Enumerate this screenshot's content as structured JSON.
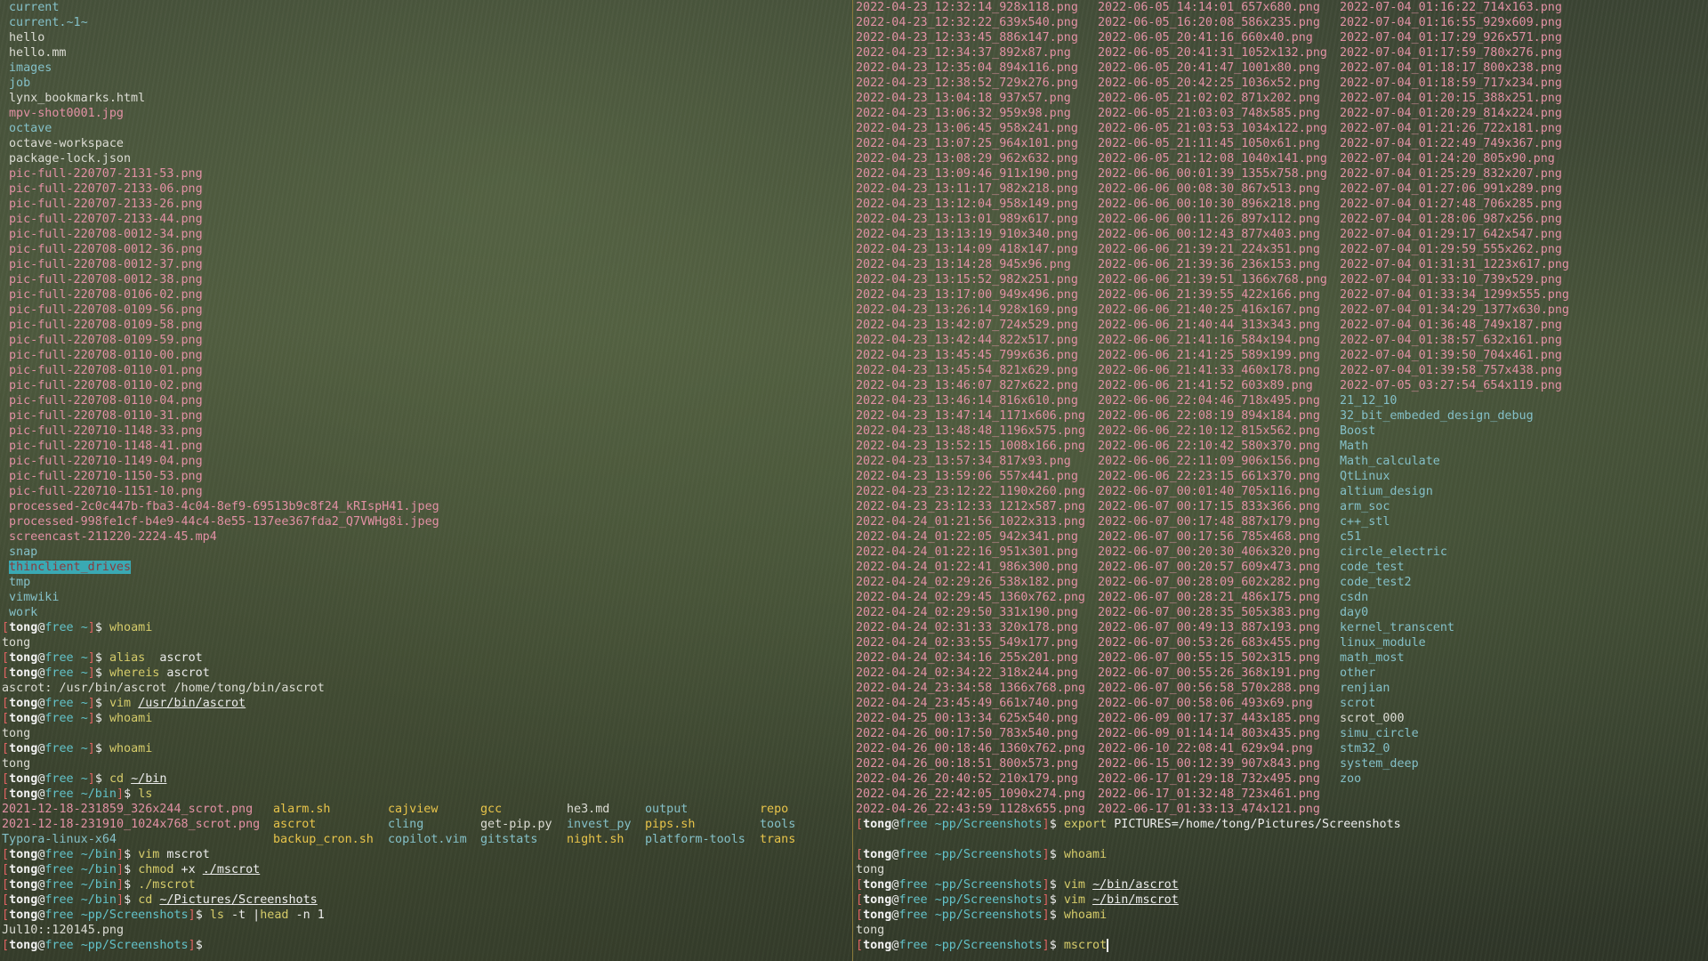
{
  "left": {
    "listing": [
      {
        "t": "current",
        "c": "dir"
      },
      {
        "t": "current.~1~",
        "c": "dir"
      },
      {
        "t": "hello",
        "c": "file"
      },
      {
        "t": "hello.mm",
        "c": "file"
      },
      {
        "t": "images",
        "c": "dir"
      },
      {
        "t": "job",
        "c": "dir"
      },
      {
        "t": "lynx_bookmarks.html",
        "c": "file"
      },
      {
        "t": "mpv-shot0001.jpg",
        "c": "img"
      },
      {
        "t": "octave",
        "c": "dir"
      },
      {
        "t": "octave-workspace",
        "c": "file"
      },
      {
        "t": "package-lock.json",
        "c": "file"
      },
      {
        "t": "pic-full-220707-2131-53.png",
        "c": "img"
      },
      {
        "t": "pic-full-220707-2133-06.png",
        "c": "img"
      },
      {
        "t": "pic-full-220707-2133-26.png",
        "c": "img"
      },
      {
        "t": "pic-full-220707-2133-44.png",
        "c": "img"
      },
      {
        "t": "pic-full-220708-0012-34.png",
        "c": "img"
      },
      {
        "t": "pic-full-220708-0012-36.png",
        "c": "img"
      },
      {
        "t": "pic-full-220708-0012-37.png",
        "c": "img"
      },
      {
        "t": "pic-full-220708-0012-38.png",
        "c": "img"
      },
      {
        "t": "pic-full-220708-0106-02.png",
        "c": "img"
      },
      {
        "t": "pic-full-220708-0109-56.png",
        "c": "img"
      },
      {
        "t": "pic-full-220708-0109-58.png",
        "c": "img"
      },
      {
        "t": "pic-full-220708-0109-59.png",
        "c": "img"
      },
      {
        "t": "pic-full-220708-0110-00.png",
        "c": "img"
      },
      {
        "t": "pic-full-220708-0110-01.png",
        "c": "img"
      },
      {
        "t": "pic-full-220708-0110-02.png",
        "c": "img"
      },
      {
        "t": "pic-full-220708-0110-04.png",
        "c": "img"
      },
      {
        "t": "pic-full-220708-0110-31.png",
        "c": "img"
      },
      {
        "t": "pic-full-220710-1148-33.png",
        "c": "img"
      },
      {
        "t": "pic-full-220710-1148-41.png",
        "c": "img"
      },
      {
        "t": "pic-full-220710-1149-04.png",
        "c": "img"
      },
      {
        "t": "pic-full-220710-1150-53.png",
        "c": "img"
      },
      {
        "t": "pic-full-220710-1151-10.png",
        "c": "img"
      },
      {
        "t": "processed-2c0c447b-fba3-4c04-8ef9-69513b9c8f24_kRIspH41.jpeg",
        "c": "img"
      },
      {
        "t": "processed-998fe1cf-b4e9-44c4-8e55-137ee367fda2_Q7VWHg8i.jpeg",
        "c": "img"
      },
      {
        "t": "screencast-211220-2224-45.mp4",
        "c": "img"
      },
      {
        "t": "snap",
        "c": "dir"
      },
      {
        "t": "thinclient_drives",
        "c": "hl"
      },
      {
        "t": "tmp",
        "c": "dir"
      },
      {
        "t": "vimwiki",
        "c": "dir"
      },
      {
        "t": "work",
        "c": "dir"
      }
    ],
    "session1": [
      {
        "type": "prompt",
        "user": "tong",
        "host": "free",
        "dir": "~",
        "parts": [
          {
            "t": "whoami",
            "c": "cmd"
          }
        ]
      },
      {
        "type": "out",
        "t": "tong"
      },
      {
        "type": "prompt",
        "user": "tong",
        "host": "free",
        "dir": "~",
        "parts": [
          {
            "t": "alias",
            "c": "cmd"
          },
          {
            "t": "  ascrot",
            "c": "dl"
          }
        ]
      },
      {
        "type": "prompt",
        "user": "tong",
        "host": "free",
        "dir": "~",
        "parts": [
          {
            "t": "whereis",
            "c": "cmd"
          },
          {
            "t": " ascrot",
            "c": "dl"
          }
        ]
      },
      {
        "type": "out",
        "t": "ascrot: /usr/bin/ascrot /home/tong/bin/ascrot"
      },
      {
        "type": "prompt",
        "user": "tong",
        "host": "free",
        "dir": "~",
        "parts": [
          {
            "t": "vim",
            "c": "cmd"
          },
          {
            "t": " ",
            "c": "dl"
          },
          {
            "t": "/usr/bin/ascrot",
            "c": "dl ul"
          }
        ]
      },
      {
        "type": "prompt",
        "user": "tong",
        "host": "free",
        "dir": "~",
        "parts": [
          {
            "t": "whoami",
            "c": "cmd"
          }
        ]
      },
      {
        "type": "out",
        "t": "tong"
      },
      {
        "type": "prompt",
        "user": "tong",
        "host": "free",
        "dir": "~",
        "parts": [
          {
            "t": "whoami",
            "c": "cmd"
          }
        ]
      },
      {
        "type": "out",
        "t": "tong"
      },
      {
        "type": "prompt",
        "user": "tong",
        "host": "free",
        "dir": "~",
        "parts": [
          {
            "t": "cd",
            "c": "cmd"
          },
          {
            "t": " ",
            "c": "dl"
          },
          {
            "t": "~/bin",
            "c": "dl ul"
          }
        ]
      },
      {
        "type": "prompt",
        "user": "tong",
        "host": "free",
        "dir": "~/bin",
        "parts": [
          {
            "t": "ls",
            "c": "cmd"
          }
        ]
      }
    ],
    "ls_rows": [
      [
        {
          "t": "2021-12-18-231859_326x244_scrot.png",
          "c": "img"
        },
        {
          "t": "alarm.sh",
          "c": "exe"
        },
        {
          "t": "cajview",
          "c": "exe"
        },
        {
          "t": "gcc",
          "c": "exe"
        },
        {
          "t": "he3.md",
          "c": "file"
        },
        {
          "t": "output",
          "c": "dir"
        },
        {
          "t": "repo",
          "c": "exe"
        }
      ],
      [
        {
          "t": "2021-12-18-231910_1024x768_scrot.png",
          "c": "img"
        },
        {
          "t": "ascrot",
          "c": "exe"
        },
        {
          "t": "cling",
          "c": "dir"
        },
        {
          "t": "get-pip.py",
          "c": "file"
        },
        {
          "t": "invest_py",
          "c": "dir"
        },
        {
          "t": "pips.sh",
          "c": "exe"
        },
        {
          "t": "tools",
          "c": "dir"
        }
      ],
      [
        {
          "t": "Typora-linux-x64",
          "c": "dir"
        },
        {
          "t": "backup_cron.sh",
          "c": "exe"
        },
        {
          "t": "copilot.vim",
          "c": "dir"
        },
        {
          "t": "gitstats",
          "c": "dir"
        },
        {
          "t": "night.sh",
          "c": "exe"
        },
        {
          "t": "platform-tools",
          "c": "dir"
        },
        {
          "t": "trans",
          "c": "exe"
        }
      ]
    ],
    "session2": [
      {
        "type": "prompt",
        "user": "tong",
        "host": "free",
        "dir": "~/bin",
        "parts": [
          {
            "t": "vim",
            "c": "cmd"
          },
          {
            "t": " mscrot",
            "c": "dl"
          }
        ]
      },
      {
        "type": "prompt",
        "user": "tong",
        "host": "free",
        "dir": "~/bin",
        "parts": [
          {
            "t": "chmod",
            "c": "cmd"
          },
          {
            "t": " +x ",
            "c": "dl"
          },
          {
            "t": "./mscrot",
            "c": "dl ul"
          }
        ]
      },
      {
        "type": "prompt",
        "user": "tong",
        "host": "free",
        "dir": "~/bin",
        "parts": [
          {
            "t": "./mscrot",
            "c": "cmd"
          }
        ]
      },
      {
        "type": "prompt",
        "user": "tong",
        "host": "free",
        "dir": "~/bin",
        "parts": [
          {
            "t": "cd",
            "c": "cmd"
          },
          {
            "t": " ",
            "c": "dl"
          },
          {
            "t": "~/Pictures/Screenshots",
            "c": "dl ul"
          }
        ]
      },
      {
        "type": "prompt",
        "user": "tong",
        "host": "free",
        "dir": "~pp/Screenshots",
        "parts": [
          {
            "t": "ls",
            "c": "cmd"
          },
          {
            "t": " -t |",
            "c": "dl"
          },
          {
            "t": "head",
            "c": "cmd"
          },
          {
            "t": " -n 1",
            "c": "dl"
          }
        ]
      },
      {
        "type": "out",
        "t": "Jul10::120145.png"
      },
      {
        "type": "prompt",
        "user": "tong",
        "host": "free",
        "dir": "~pp/Screenshots",
        "parts": []
      }
    ]
  },
  "right": {
    "col1": [
      "2022-04-23_12:32:14_928x118.png",
      "2022-04-23_12:32:22_639x540.png",
      "2022-04-23_12:33:45_886x147.png",
      "2022-04-23_12:34:37_892x87.png",
      "2022-04-23_12:35:04_894x116.png",
      "2022-04-23_12:38:52_729x276.png",
      "2022-04-23_13:04:18_937x57.png",
      "2022-04-23_13:06:32_959x98.png",
      "2022-04-23_13:06:45_958x241.png",
      "2022-04-23_13:07:25_964x101.png",
      "2022-04-23_13:08:29_962x632.png",
      "2022-04-23_13:09:46_911x190.png",
      "2022-04-23_13:11:17_982x218.png",
      "2022-04-23_13:12:04_958x149.png",
      "2022-04-23_13:13:01_989x617.png",
      "2022-04-23_13:13:19_910x340.png",
      "2022-04-23_13:14:09_418x147.png",
      "2022-04-23_13:14:28_945x96.png",
      "2022-04-23_13:15:52_982x251.png",
      "2022-04-23_13:17:00_949x496.png",
      "2022-04-23_13:26:14_928x169.png",
      "2022-04-23_13:42:07_724x529.png",
      "2022-04-23_13:42:44_822x517.png",
      "2022-04-23_13:45:45_799x636.png",
      "2022-04-23_13:45:54_821x629.png",
      "2022-04-23_13:46:07_827x622.png",
      "2022-04-23_13:46:14_816x610.png",
      "2022-04-23_13:47:14_1171x606.png",
      "2022-04-23_13:48:48_1196x575.png",
      "2022-04-23_13:52:15_1008x166.png",
      "2022-04-23_13:57:34_817x93.png",
      "2022-04-23_13:59:06_557x441.png",
      "2022-04-23_23:12:22_1190x260.png",
      "2022-04-23_23:12:33_1212x587.png",
      "2022-04-24_01:21:56_1022x313.png",
      "2022-04-24_01:22:05_942x341.png",
      "2022-04-24_01:22:16_951x301.png",
      "2022-04-24_01:22:41_986x300.png",
      "2022-04-24_02:29:26_538x182.png",
      "2022-04-24_02:29:45_1360x762.png",
      "2022-04-24_02:29:50_331x190.png",
      "2022-04-24_02:31:33_320x178.png",
      "2022-04-24_02:33:55_549x177.png",
      "2022-04-24_02:34:16_255x201.png",
      "2022-04-24_02:34:22_318x244.png",
      "2022-04-24_23:34:58_1366x768.png",
      "2022-04-24_23:45:49_661x740.png",
      "2022-04-25_00:13:34_625x540.png",
      "2022-04-26_00:17:50_783x540.png",
      "2022-04-26_00:18:46_1360x762.png",
      "2022-04-26_00:18:51_800x573.png",
      "2022-04-26_20:40:52_210x179.png",
      "2022-04-26_22:42:05_1090x274.png",
      "2022-04-26_22:43:59_1128x655.png"
    ],
    "col2": [
      "2022-06-05_14:14:01_657x680.png",
      "2022-06-05_16:20:08_586x235.png",
      "2022-06-05_20:41:16_660x40.png",
      "2022-06-05_20:41:31_1052x132.png",
      "2022-06-05_20:41:47_1001x80.png",
      "2022-06-05_20:42:25_1036x52.png",
      "2022-06-05_21:02:02_871x202.png",
      "2022-06-05_21:03:03_748x585.png",
      "2022-06-05_21:03:53_1034x122.png",
      "2022-06-05_21:11:45_1050x61.png",
      "2022-06-05_21:12:08_1040x141.png",
      "2022-06-06_00:01:39_1355x758.png",
      "2022-06-06_00:08:30_867x513.png",
      "2022-06-06_00:10:30_896x218.png",
      "2022-06-06_00:11:26_897x112.png",
      "2022-06-06_00:12:43_877x403.png",
      "2022-06-06_21:39:21_224x351.png",
      "2022-06-06_21:39:36_236x153.png",
      "2022-06-06_21:39:51_1366x768.png",
      "2022-06-06_21:39:55_422x166.png",
      "2022-06-06_21:40:25_416x167.png",
      "2022-06-06_21:40:44_313x343.png",
      "2022-06-06_21:41:16_584x194.png",
      "2022-06-06_21:41:25_589x199.png",
      "2022-06-06_21:41:33_460x178.png",
      "2022-06-06_21:41:52_603x89.png",
      "2022-06-06_22:04:46_718x495.png",
      "2022-06-06_22:08:19_894x184.png",
      "2022-06-06_22:10:12_815x562.png",
      "2022-06-06_22:10:42_580x370.png",
      "2022-06-06_22:11:09_906x156.png",
      "2022-06-06_22:23:15_661x370.png",
      "2022-06-07_00:01:40_705x116.png",
      "2022-06-07_00:17:15_833x366.png",
      "2022-06-07_00:17:48_887x179.png",
      "2022-06-07_00:17:56_785x468.png",
      "2022-06-07_00:20:30_406x320.png",
      "2022-06-07_00:20:57_609x473.png",
      "2022-06-07_00:28:09_602x282.png",
      "2022-06-07_00:28:21_486x175.png",
      "2022-06-07_00:28:35_505x383.png",
      "2022-06-07_00:49:13_887x193.png",
      "2022-06-07_00:53:26_683x455.png",
      "2022-06-07_00:55:15_502x315.png",
      "2022-06-07_00:55:26_368x191.png",
      "2022-06-07_00:56:58_570x288.png",
      "2022-06-07_00:58:06_493x69.png",
      "2022-06-09_00:17:37_443x185.png",
      "2022-06-09_01:14:14_803x435.png",
      "2022-06-10_22:08:41_629x94.png",
      "2022-06-15_00:12:39_907x843.png",
      "2022-06-17_01:29:18_732x495.png",
      "2022-06-17_01:32:48_723x461.png",
      "2022-06-17_01:33:13_474x121.png"
    ],
    "col3": [
      {
        "t": "2022-07-04_01:16:22_714x163.png",
        "c": "img"
      },
      {
        "t": "2022-07-04_01:16:55_929x609.png",
        "c": "img"
      },
      {
        "t": "2022-07-04_01:17:29_926x571.png",
        "c": "img"
      },
      {
        "t": "2022-07-04_01:17:59_780x276.png",
        "c": "img"
      },
      {
        "t": "2022-07-04_01:18:17_800x238.png",
        "c": "img"
      },
      {
        "t": "2022-07-04_01:18:59_717x234.png",
        "c": "img"
      },
      {
        "t": "2022-07-04_01:20:15_388x251.png",
        "c": "img"
      },
      {
        "t": "2022-07-04_01:20:29_814x224.png",
        "c": "img"
      },
      {
        "t": "2022-07-04_01:21:26_722x181.png",
        "c": "img"
      },
      {
        "t": "2022-07-04_01:22:49_749x367.png",
        "c": "img"
      },
      {
        "t": "2022-07-04_01:24:20_805x90.png",
        "c": "img"
      },
      {
        "t": "2022-07-04_01:25:29_832x207.png",
        "c": "img"
      },
      {
        "t": "2022-07-04_01:27:06_991x289.png",
        "c": "img"
      },
      {
        "t": "2022-07-04_01:27:48_706x285.png",
        "c": "img"
      },
      {
        "t": "2022-07-04_01:28:06_987x256.png",
        "c": "img"
      },
      {
        "t": "2022-07-04_01:29:17_642x547.png",
        "c": "img"
      },
      {
        "t": "2022-07-04_01:29:59_555x262.png",
        "c": "img"
      },
      {
        "t": "2022-07-04_01:31:31_1223x617.png",
        "c": "img"
      },
      {
        "t": "2022-07-04_01:33:10_739x529.png",
        "c": "img"
      },
      {
        "t": "2022-07-04_01:33:34_1299x555.png",
        "c": "img"
      },
      {
        "t": "2022-07-04_01:34:29_1377x630.png",
        "c": "img"
      },
      {
        "t": "2022-07-04_01:36:48_749x187.png",
        "c": "img"
      },
      {
        "t": "2022-07-04_01:38:57_632x161.png",
        "c": "img"
      },
      {
        "t": "2022-07-04_01:39:50_704x461.png",
        "c": "img"
      },
      {
        "t": "2022-07-04_01:39:58_757x438.png",
        "c": "img"
      },
      {
        "t": "2022-07-05_03:27:54_654x119.png",
        "c": "img"
      },
      {
        "t": "21_12_10",
        "c": "dir"
      },
      {
        "t": "32_bit_embeded_design_debug",
        "c": "dir"
      },
      {
        "t": "Boost",
        "c": "dir"
      },
      {
        "t": "Math",
        "c": "dir"
      },
      {
        "t": "Math_calculate",
        "c": "dir"
      },
      {
        "t": "QtLinux",
        "c": "dir"
      },
      {
        "t": "altium_design",
        "c": "dir"
      },
      {
        "t": "arm_soc",
        "c": "dir"
      },
      {
        "t": "c++_stl",
        "c": "dir"
      },
      {
        "t": "c51",
        "c": "dir"
      },
      {
        "t": "circle_electric",
        "c": "dir"
      },
      {
        "t": "code_test",
        "c": "dir"
      },
      {
        "t": "code_test2",
        "c": "dir"
      },
      {
        "t": "csdn",
        "c": "dir"
      },
      {
        "t": "day0",
        "c": "dir"
      },
      {
        "t": "kernel_transcent",
        "c": "dir"
      },
      {
        "t": "linux_module",
        "c": "dir"
      },
      {
        "t": "math_most",
        "c": "dir"
      },
      {
        "t": "other",
        "c": "dir"
      },
      {
        "t": "renjian",
        "c": "dir"
      },
      {
        "t": "scrot",
        "c": "dir"
      },
      {
        "t": "scrot_000",
        "c": "file"
      },
      {
        "t": "simu_circle",
        "c": "dir"
      },
      {
        "t": "stm32_0",
        "c": "dir"
      },
      {
        "t": "system_deep",
        "c": "dir"
      },
      {
        "t": "zoo",
        "c": "dir"
      }
    ],
    "session": [
      {
        "type": "prompt",
        "user": "tong",
        "host": "free",
        "dir": "~pp/Screenshots",
        "parts": [
          {
            "t": "export",
            "c": "cmd"
          },
          {
            "t": " PICTURES=/home/tong/Pictures/Screenshots",
            "c": "dl"
          }
        ]
      },
      {
        "type": "out",
        "t": ""
      },
      {
        "type": "prompt",
        "user": "tong",
        "host": "free",
        "dir": "~pp/Screenshots",
        "parts": [
          {
            "t": "whoami",
            "c": "cmd"
          }
        ]
      },
      {
        "type": "out",
        "t": "tong"
      },
      {
        "type": "prompt",
        "user": "tong",
        "host": "free",
        "dir": "~pp/Screenshots",
        "parts": [
          {
            "t": "vim",
            "c": "cmd"
          },
          {
            "t": " ",
            "c": "dl"
          },
          {
            "t": "~/bin/ascrot",
            "c": "dl ul"
          }
        ]
      },
      {
        "type": "prompt",
        "user": "tong",
        "host": "free",
        "dir": "~pp/Screenshots",
        "parts": [
          {
            "t": "vim",
            "c": "cmd"
          },
          {
            "t": " ",
            "c": "dl"
          },
          {
            "t": "~/bin/mscrot",
            "c": "dl ul"
          }
        ]
      },
      {
        "type": "prompt",
        "user": "tong",
        "host": "free",
        "dir": "~pp/Screenshots",
        "parts": [
          {
            "t": "whoami",
            "c": "cmd"
          }
        ]
      },
      {
        "type": "out",
        "t": "tong"
      },
      {
        "type": "prompt",
        "user": "tong",
        "host": "free",
        "dir": "~pp/Screenshots",
        "parts": [
          {
            "t": "mscrot",
            "c": "cmd"
          }
        ],
        "cursor": true
      }
    ]
  },
  "colors": {
    "image_file": "#e290a4",
    "directory": "#84c0c8",
    "executable": "#e8c44a",
    "bracket": "#e06262",
    "host": "#62c2c9",
    "pane_divider": "#8a7a3a"
  }
}
